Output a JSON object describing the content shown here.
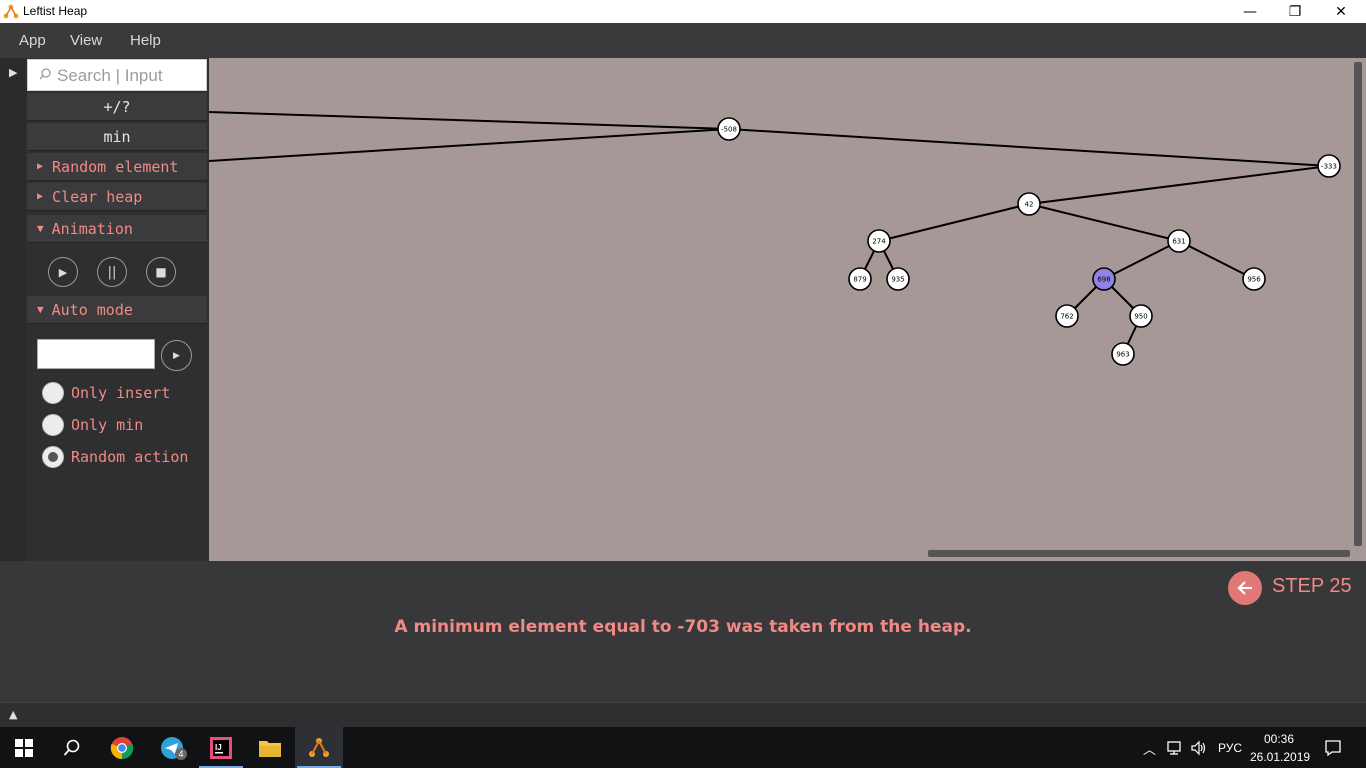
{
  "window": {
    "title": "Leftist Heap"
  },
  "titlebar_controls": {
    "minimize": "—",
    "restore": "❐",
    "close": "✕"
  },
  "menu": [
    "App",
    "View",
    "Help"
  ],
  "sidebar": {
    "search_placeholder": "Search | Input",
    "buttons": {
      "insert": "+/?",
      "min": "min"
    },
    "sections": {
      "random_element": "Random element",
      "clear_heap": "Clear heap",
      "animation": "Animation",
      "auto_mode": "Auto mode"
    },
    "radio_options": [
      {
        "label": "Only insert",
        "selected": false
      },
      {
        "label": "Only min",
        "selected": false
      },
      {
        "label": "Random action",
        "selected": true
      }
    ]
  },
  "tree": {
    "nodes": [
      {
        "id": "n-508",
        "label": "-508",
        "highlight": false
      },
      {
        "id": "n-333",
        "label": "-333",
        "highlight": false
      },
      {
        "id": "n42",
        "label": "42",
        "highlight": false
      },
      {
        "id": "n274",
        "label": "274",
        "highlight": false
      },
      {
        "id": "n879",
        "label": "879",
        "highlight": false
      },
      {
        "id": "n935",
        "label": "935",
        "highlight": false
      },
      {
        "id": "n631",
        "label": "631",
        "highlight": false
      },
      {
        "id": "n698",
        "label": "698",
        "highlight": true
      },
      {
        "id": "n956",
        "label": "956",
        "highlight": false
      },
      {
        "id": "n762",
        "label": "762",
        "highlight": false
      },
      {
        "id": "n950",
        "label": "950",
        "highlight": false
      },
      {
        "id": "n963",
        "label": "963",
        "highlight": false
      }
    ],
    "edges": [
      [
        "n-508",
        "n-333"
      ],
      [
        "n-333",
        "n42"
      ],
      [
        "n42",
        "n274"
      ],
      [
        "n42",
        "n631"
      ],
      [
        "n274",
        "n879"
      ],
      [
        "n274",
        "n935"
      ],
      [
        "n631",
        "n698"
      ],
      [
        "n631",
        "n956"
      ],
      [
        "n698",
        "n762"
      ],
      [
        "n698",
        "n950"
      ],
      [
        "n950",
        "n963"
      ]
    ],
    "highlight_color": "#8f84e6"
  },
  "step": {
    "label": "STEP 25"
  },
  "message": "A minimum element equal to -703 was taken from the heap.",
  "taskbar": {
    "tray_lang": "РУС",
    "time": "00:36",
    "date": "26.01.2019",
    "telegram_badge": "4"
  },
  "colors": {
    "accent": "#f08a84",
    "canvas": "#a79898",
    "step_button": "#e17777"
  }
}
